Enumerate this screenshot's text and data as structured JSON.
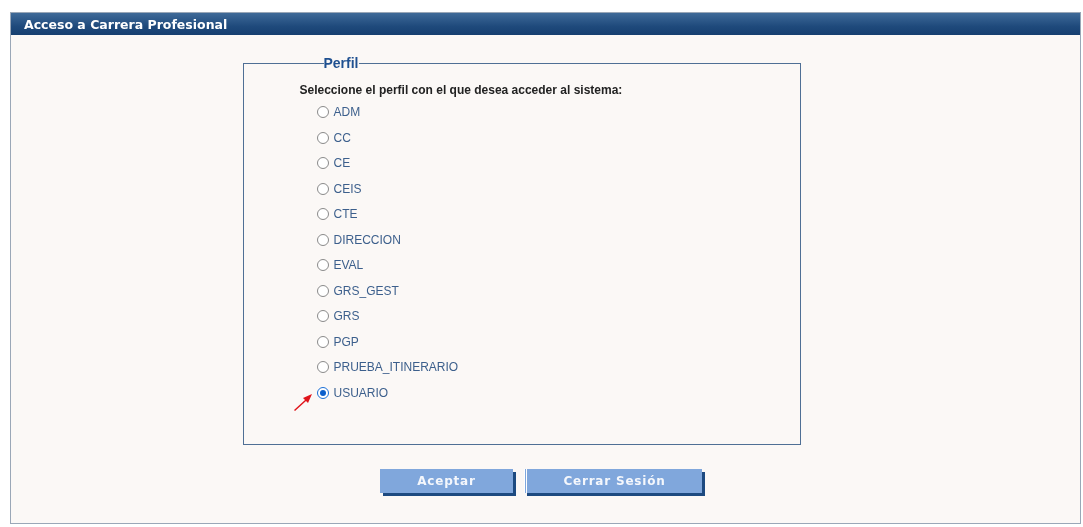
{
  "window": {
    "title": "Acceso a Carrera Profesional"
  },
  "profile_panel": {
    "legend": "Perfil",
    "prompt": "Seleccione el perfil con el que desea acceder al sistema:",
    "options": [
      {
        "label": "ADM",
        "selected": false
      },
      {
        "label": "CC",
        "selected": false
      },
      {
        "label": "CE",
        "selected": false
      },
      {
        "label": "CEIS",
        "selected": false
      },
      {
        "label": "CTE",
        "selected": false
      },
      {
        "label": "DIRECCION",
        "selected": false
      },
      {
        "label": "EVAL",
        "selected": false
      },
      {
        "label": "GRS_GEST",
        "selected": false
      },
      {
        "label": "GRS",
        "selected": false
      },
      {
        "label": "PGP",
        "selected": false
      },
      {
        "label": "PRUEBA_ITINERARIO",
        "selected": false
      },
      {
        "label": "USUARIO",
        "selected": true
      }
    ]
  },
  "buttons": [
    "Aceptar",
    "Cerrar Sesión"
  ]
}
